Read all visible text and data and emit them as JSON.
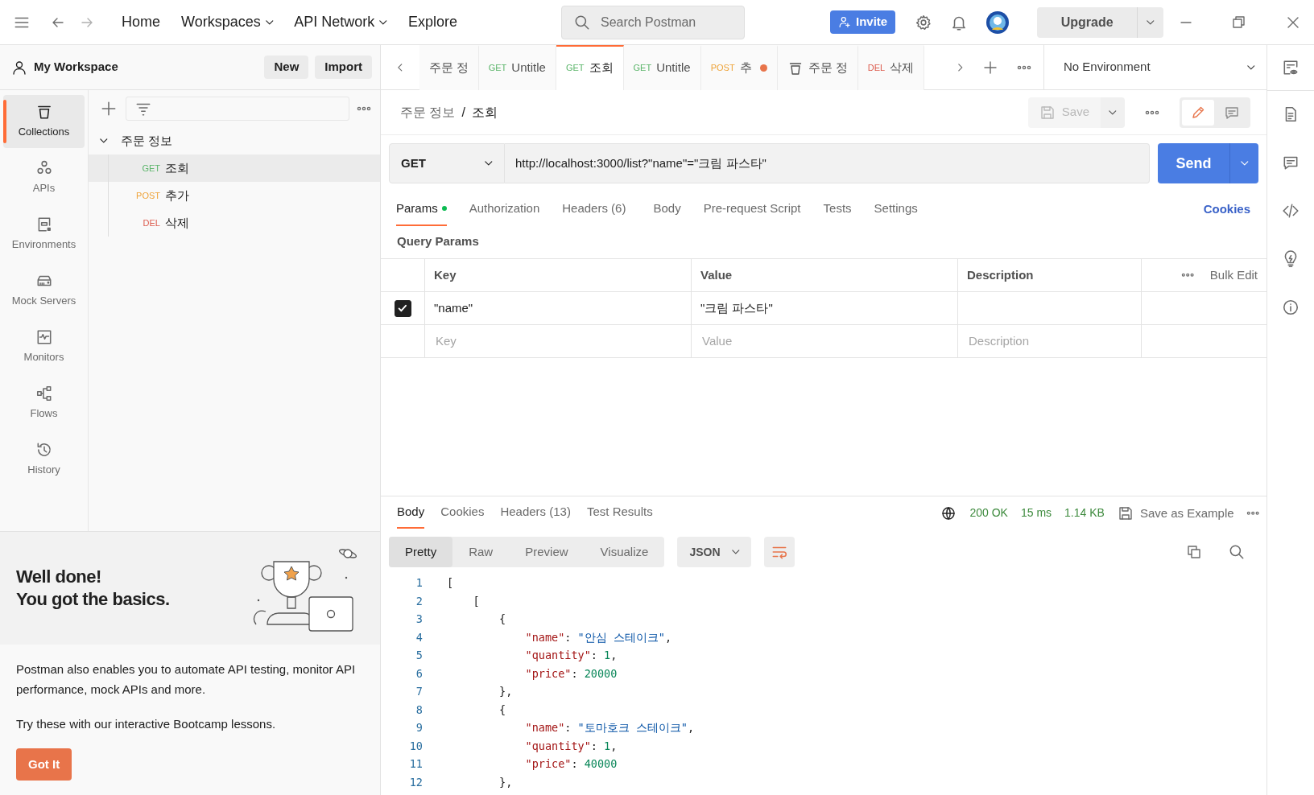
{
  "titlebar": {
    "nav": [
      {
        "label": "Home",
        "dropdown": false
      },
      {
        "label": "Workspaces",
        "dropdown": true
      },
      {
        "label": "API Network",
        "dropdown": true
      },
      {
        "label": "Explore",
        "dropdown": false
      }
    ],
    "search": {
      "placeholder": "Search Postman"
    },
    "invite": "Invite",
    "upgrade": "Upgrade"
  },
  "workspace": {
    "name": "My Workspace",
    "buttons": [
      "New",
      "Import"
    ]
  },
  "sidebar": {
    "items": [
      {
        "kind": "collections",
        "label": "Collections",
        "selected": true
      },
      {
        "kind": "apis",
        "label": "APIs",
        "selected": false
      },
      {
        "kind": "environments",
        "label": "Environments",
        "selected": false
      },
      {
        "kind": "mock",
        "label": "Mock Servers",
        "selected": false
      },
      {
        "kind": "monitors",
        "label": "Monitors",
        "selected": false
      },
      {
        "kind": "flows",
        "label": "Flows",
        "selected": false
      },
      {
        "kind": "history",
        "label": "History",
        "selected": false
      }
    ]
  },
  "collection": {
    "name": "주문 정보",
    "expanded": true,
    "children": [
      {
        "method": "GET",
        "name": "조회",
        "selected": true
      },
      {
        "method": "POST",
        "name": "추가",
        "selected": false
      },
      {
        "method": "DEL",
        "name": "삭제",
        "selected": false
      }
    ]
  },
  "tabs": [
    {
      "kind": "plain",
      "label": "주문 정",
      "selected": false,
      "unsaved": false
    },
    {
      "kind": "request",
      "method": "GET",
      "label": "Untitle",
      "selected": false,
      "unsaved": false
    },
    {
      "kind": "request",
      "method": "GET",
      "label": "조회",
      "selected": true,
      "unsaved": false
    },
    {
      "kind": "request",
      "method": "GET",
      "label": "Untitle",
      "selected": false,
      "unsaved": false
    },
    {
      "kind": "request",
      "method": "POST",
      "label": "추",
      "selected": false,
      "unsaved": true
    },
    {
      "kind": "collection",
      "label": "주문 정",
      "selected": false,
      "unsaved": false
    },
    {
      "kind": "request",
      "method": "DEL",
      "label": "삭제",
      "selected": false,
      "unsaved": false
    }
  ],
  "environment": "No Environment",
  "request": {
    "breadcrumb": [
      "주문 정보",
      "조회"
    ],
    "breadcrumb_separator": "/",
    "save": {
      "label": "Save",
      "disabled": true
    },
    "view_modes": [
      {
        "kind": "edit",
        "selected": true
      },
      {
        "kind": "comments",
        "selected": false
      }
    ],
    "method": "GET",
    "url": "http://localhost:3000/list?\"name\"=\"크림 파스타\"",
    "send": "Send",
    "tabs": [
      {
        "label": "Params",
        "selected": true,
        "dot": true
      },
      {
        "label": "Authorization",
        "selected": false,
        "dot": false
      },
      {
        "label": "Headers (6)",
        "selected": false,
        "dot": false
      },
      {
        "label": "Body",
        "selected": false,
        "dot": false
      },
      {
        "label": "Pre-request Script",
        "selected": false,
        "dot": false
      },
      {
        "label": "Tests",
        "selected": false,
        "dot": false
      },
      {
        "label": "Settings",
        "selected": false,
        "dot": false
      }
    ],
    "cookies": "Cookies",
    "section_title": "Query Params",
    "params": {
      "columns": [
        "Key",
        "Value",
        "Description"
      ],
      "bulk_edit": "Bulk Edit",
      "rows": [
        {
          "checked": true,
          "key": "\"name\"",
          "value": "\"크림 파스타\""
        }
      ],
      "new_row": {
        "key": {
          "placeholder": "Key"
        },
        "value": {
          "placeholder": "Value"
        },
        "description": {
          "placeholder": "Description"
        }
      }
    }
  },
  "response": {
    "tabs": [
      {
        "label": "Body",
        "selected": true
      },
      {
        "label": "Cookies",
        "selected": false
      },
      {
        "label": "Headers (13)",
        "selected": false
      },
      {
        "label": "Test Results",
        "selected": false
      }
    ],
    "status": "200 OK",
    "time": "15 ms",
    "size": "1.14 KB",
    "save_example": "Save as Example",
    "views": [
      {
        "label": "Pretty",
        "selected": true
      },
      {
        "label": "Raw",
        "selected": false
      },
      {
        "label": "Preview",
        "selected": false
      },
      {
        "label": "Visualize",
        "selected": false
      }
    ],
    "format": "JSON",
    "lines": [
      {
        "number": "1",
        "tokens": [
          {
            "kind": "punct",
            "text": "["
          }
        ]
      },
      {
        "number": "2",
        "tokens": [
          {
            "kind": "punct",
            "text": "    ["
          }
        ]
      },
      {
        "number": "3",
        "tokens": [
          {
            "kind": "punct",
            "text": "        {"
          }
        ]
      },
      {
        "number": "4",
        "tokens": [
          {
            "kind": "key",
            "text": "            \"name\""
          },
          {
            "kind": "punct",
            "text": ": "
          },
          {
            "kind": "string",
            "text": "\"안심 스테이크\""
          },
          {
            "kind": "punct",
            "text": ","
          }
        ]
      },
      {
        "number": "5",
        "tokens": [
          {
            "kind": "key",
            "text": "            \"quantity\""
          },
          {
            "kind": "punct",
            "text": ": "
          },
          {
            "kind": "number",
            "text": "1"
          },
          {
            "kind": "punct",
            "text": ","
          }
        ]
      },
      {
        "number": "6",
        "tokens": [
          {
            "kind": "key",
            "text": "            \"price\""
          },
          {
            "kind": "punct",
            "text": ": "
          },
          {
            "kind": "number",
            "text": "20000"
          }
        ]
      },
      {
        "number": "7",
        "tokens": [
          {
            "kind": "punct",
            "text": "        },"
          }
        ]
      },
      {
        "number": "8",
        "tokens": [
          {
            "kind": "punct",
            "text": "        {"
          }
        ]
      },
      {
        "number": "9",
        "tokens": [
          {
            "kind": "key",
            "text": "            \"name\""
          },
          {
            "kind": "punct",
            "text": ": "
          },
          {
            "kind": "string",
            "text": "\"토마호크 스테이크\""
          },
          {
            "kind": "punct",
            "text": ","
          }
        ]
      },
      {
        "number": "10",
        "tokens": [
          {
            "kind": "key",
            "text": "            \"quantity\""
          },
          {
            "kind": "punct",
            "text": ": "
          },
          {
            "kind": "number",
            "text": "1"
          },
          {
            "kind": "punct",
            "text": ","
          }
        ]
      },
      {
        "number": "11",
        "tokens": [
          {
            "kind": "key",
            "text": "            \"price\""
          },
          {
            "kind": "punct",
            "text": ": "
          },
          {
            "kind": "number",
            "text": "40000"
          }
        ]
      },
      {
        "number": "12",
        "tokens": [
          {
            "kind": "punct",
            "text": "        },"
          }
        ]
      }
    ]
  },
  "onboarding": {
    "title": [
      "Well done!",
      "You got the basics."
    ],
    "paragraphs": [
      "Postman also enables you to automate API testing, monitor API performance, mock APIs and more.",
      "Try these with our interactive Bootcamp lessons."
    ],
    "button": "Got It"
  }
}
